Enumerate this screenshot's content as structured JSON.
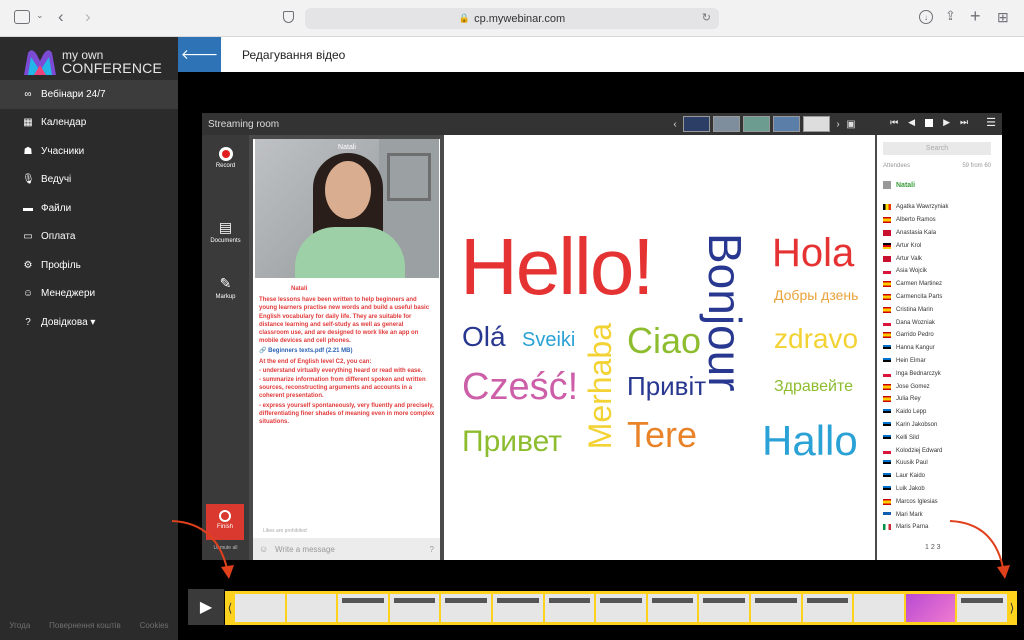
{
  "browser": {
    "url": "cp.mywebinar.com"
  },
  "logo": {
    "line1": "my own",
    "line2": "CONFERENCE"
  },
  "sidebar": {
    "items": [
      {
        "label": "Вебінари 24/7",
        "icon": "infinity-icon"
      },
      {
        "label": "Календар",
        "icon": "calendar-icon"
      },
      {
        "label": "Учасники",
        "icon": "users-icon"
      },
      {
        "label": "Ведучі",
        "icon": "microphone-icon"
      },
      {
        "label": "Файли",
        "icon": "folder-icon"
      },
      {
        "label": "Оплата",
        "icon": "credit-card-icon"
      },
      {
        "label": "Профіль",
        "icon": "gear-icon"
      },
      {
        "label": "Менеджери",
        "icon": "manager-icon"
      },
      {
        "label": "Довідкова ▾",
        "icon": "help-icon"
      }
    ],
    "footer": [
      "Угода",
      "Повернення коштів",
      "Cookies"
    ]
  },
  "header": {
    "title": "Редагування відео"
  },
  "room": {
    "title": "Streaming room",
    "tools": {
      "record": "Record",
      "documents": "Documents",
      "markup": "Markup",
      "finish": "Finish",
      "unmute": "Unmute all"
    },
    "video_name": "Natali",
    "chat": {
      "author": "Natali",
      "text1": "These lessons have been written to help beginners and young learners practise new words and build a useful basic English vocabulary for daily life. They are suitable for distance learning and self-study as well as general classroom use, and are designed to work like an app on mobile devices and cell phones.",
      "file": "🔗 Beginners texts.pdf (2.21 MB)",
      "text2": "At the end of English level C2, you can:",
      "text3": "- understand virtually everything heard or read with ease.",
      "text4": "- summarize information from different spoken and written sources, reconstructing arguments and accounts in a coherent presentation.",
      "text5": "- express yourself spontaneously, very fluently and precisely, differentiating finer shades of meaning even in more complex situations.",
      "placeholder": "Write a message",
      "likes": "Likes are prohibited"
    },
    "words": {
      "hello": "Hello!",
      "hola": "Hola",
      "bonjour": "Bonjour",
      "dobry": "Добры дзень",
      "ola": "Olá",
      "sveiki": "Sveiki",
      "merhaba": "Merhaba",
      "ciao": "Ciao",
      "zdravo": "zdravo",
      "czesc": "Cześć!",
      "pryvit": "Привіт",
      "zdravejte": "Здравейте",
      "privet": "Привет",
      "tere": "Tere",
      "hallo": "Hallo"
    },
    "attendees": {
      "search_placeholder": "Search",
      "label": "Attendees",
      "count": "59 from 60",
      "host": "Natali",
      "list": [
        "Agatka Wawrzyniak",
        "Alberto Ramos",
        "Anastasia Kala",
        "Artur Krol",
        "Artur Valk",
        "Asia Wojcik",
        "Carmen Martinez",
        "Carmencita Parts",
        "Cristina Marin",
        "Dana Wozniak",
        "Garrido Pedro",
        "Hanna Kangur",
        "Hein Elmar",
        "Inga Bednarczyk",
        "Jose Gomez",
        "Julia Rey",
        "Kaido Lepp",
        "Karin Jakobson",
        "Kelli Sild",
        "Kolodziej Edward",
        "Kuusik Paul",
        "Laur Kaido",
        "Luik Jakob",
        "Marcos Iglesias",
        "Mari Mark",
        "Maris Parna"
      ],
      "pager": "1  2  3"
    }
  },
  "timeline": {
    "play_icon": "play-icon"
  },
  "colors": {
    "accent": "#2f73b7",
    "sidebar": "#2b2b2b",
    "timeline": "#ffd21e",
    "finish": "#d9392e"
  }
}
